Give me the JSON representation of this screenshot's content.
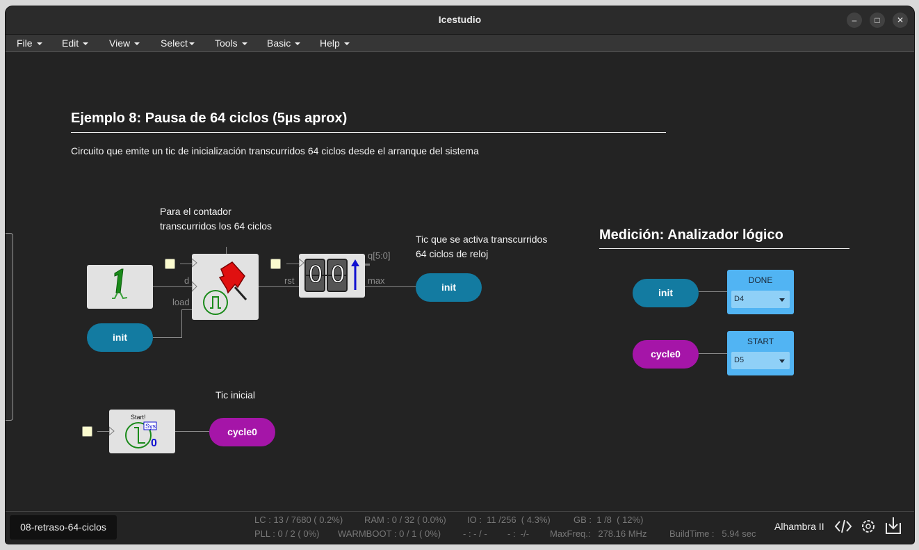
{
  "window": {
    "title": "Icestudio",
    "minimize": "–",
    "maximize": "□",
    "close": "✕"
  },
  "menu": [
    "File",
    "Edit",
    "View",
    "Select",
    "Tools",
    "Basic",
    "Help"
  ],
  "canvas": {
    "title": "Ejemplo 8: Pausa de 64 ciclos (5µs aprox)",
    "description": "Circuito que emite un tic de inicialización transcurridos 64 ciclos desde el arranque del sistema",
    "comment_counter": [
      "Para el contador",
      "transcurridos los 64 ciclos"
    ],
    "comment_tick": [
      "Tic que se activa transcurridos",
      "64 ciclos de reloj"
    ],
    "comment_initial": "Tic inicial",
    "measure_title": "Medición: Analizador lógico",
    "ports": {
      "d": "d",
      "load": "load",
      "rst": "rst",
      "q": "q[5:0]",
      "max": "max"
    },
    "counter_digits": [
      "0",
      "0"
    ],
    "start_block": {
      "label": "Start!",
      "badge": "Sys",
      "digit": "0"
    },
    "labels": {
      "init_input": "init",
      "init_output": "init",
      "init_meas": "init",
      "cycle0_out": "cycle0",
      "cycle0_meas": "cycle0"
    },
    "outputs": [
      {
        "name": "DONE",
        "pin": "D4"
      },
      {
        "name": "START",
        "pin": "D5"
      }
    ],
    "colors": {
      "blue_label": "#137ba1",
      "purple_label": "#a515a8",
      "output_block": "#51b4f3"
    },
    "icons": [
      "constant-one-icon",
      "pushpin-icon",
      "pulse-icon",
      "counter-icon",
      "start-tick-icon"
    ]
  },
  "status": {
    "project": "08-retraso-64-ciclos",
    "row1": [
      "LC : 13 / 7680 ( 0.2%)",
      "RAM : 0 / 32 ( 0.0%)",
      "IO :  11 /256  ( 4.3%)",
      "GB :  1 /8  ( 12%)"
    ],
    "row2": [
      "PLL : 0 / 2 ( 0%)",
      "WARMBOOT : 0 / 1 ( 0%)",
      "- : - / -",
      "- :  -/-",
      "MaxFreq.:   278.16 MHz",
      "BuildTime :   5.94 sec"
    ],
    "board": "Alhambra II",
    "icons": [
      "code-icon",
      "settings-icon",
      "download-icon"
    ]
  }
}
